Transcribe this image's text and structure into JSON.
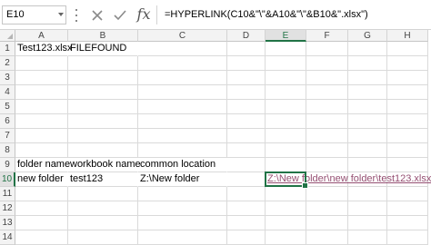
{
  "formula_bar": {
    "name_box": "E10",
    "cancel_icon": "close-icon",
    "enter_icon": "check-icon",
    "fx_label": "fx",
    "formula": "=HYPERLINK(C10&\"\\\"&A10&\"\\\"&B10&\".xlsx\")"
  },
  "columns": [
    "A",
    "B",
    "C",
    "D",
    "E",
    "F",
    "G",
    "H"
  ],
  "rows": [
    "1",
    "2",
    "3",
    "4",
    "5",
    "6",
    "7",
    "8",
    "9",
    "10",
    "11",
    "12",
    "13",
    "14"
  ],
  "cells": {
    "A1": "Test123.xlsx",
    "B1": "FILEFOUND",
    "A9": "folder name",
    "B9": "workbook name",
    "C9": "common location",
    "A10": "new folder",
    "B10": "test123",
    "C10": "Z:\\New folder",
    "E10": "Z:\\New folder\\new folder\\test123.xlsx"
  },
  "active_cell": "E10",
  "colors": {
    "accent": "#217346",
    "hyperlink": "#954f72"
  }
}
